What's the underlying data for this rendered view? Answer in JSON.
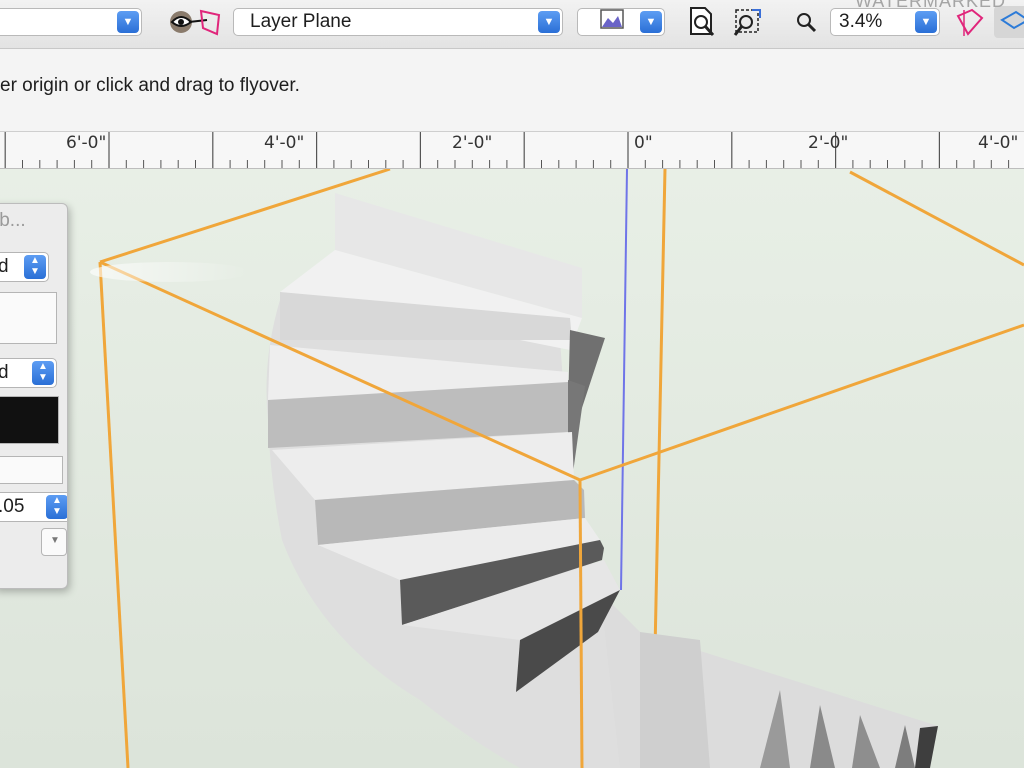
{
  "toolbar": {
    "layer_plane_label": "Layer Plane",
    "zoom_value": "3.4%",
    "watermark": "WATERMARKED"
  },
  "status": {
    "message": "er origin or click and drag to flyover."
  },
  "ruler": {
    "labels": [
      "6'-0\"",
      "4'-0\"",
      "2'-0\"",
      "0\"",
      "2'-0\"",
      "4'-0\""
    ]
  },
  "palette": {
    "title": "ib...",
    "popup1_value": "d",
    "popup2_value": "d",
    "number_value": ".05"
  },
  "colors": {
    "bounding_box": "#f0a63a",
    "origin_line": "#6f74e8",
    "accent": "#2a6fd6"
  }
}
